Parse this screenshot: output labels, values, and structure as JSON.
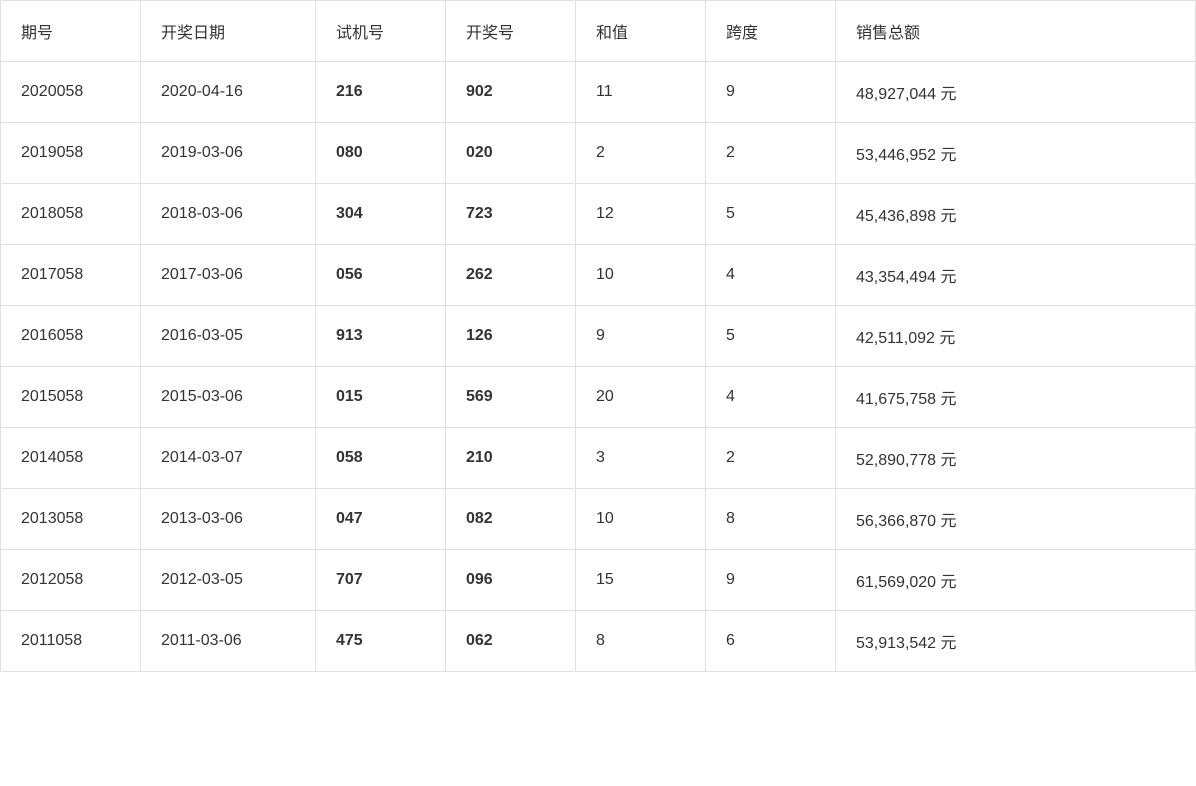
{
  "table": {
    "headers": [
      "期号",
      "开奖日期",
      "试机号",
      "开奖号",
      "和值",
      "跨度",
      "销售总额"
    ],
    "rows": [
      {
        "qihao": "2020058",
        "date": "2020-04-16",
        "shiji": "216",
        "kaijang": "902",
        "hezhi": "11",
        "kuadu": "9",
        "sales": "48,927,044 元"
      },
      {
        "qihao": "2019058",
        "date": "2019-03-06",
        "shiji": "080",
        "kaijang": "020",
        "hezhi": "2",
        "kuadu": "2",
        "sales": "53,446,952 元"
      },
      {
        "qihao": "2018058",
        "date": "2018-03-06",
        "shiji": "304",
        "kaijang": "723",
        "hezhi": "12",
        "kuadu": "5",
        "sales": "45,436,898 元"
      },
      {
        "qihao": "2017058",
        "date": "2017-03-06",
        "shiji": "056",
        "kaijang": "262",
        "hezhi": "10",
        "kuadu": "4",
        "sales": "43,354,494 元"
      },
      {
        "qihao": "2016058",
        "date": "2016-03-05",
        "shiji": "913",
        "kaijang": "126",
        "hezhi": "9",
        "kuadu": "5",
        "sales": "42,511,092 元"
      },
      {
        "qihao": "2015058",
        "date": "2015-03-06",
        "shiji": "015",
        "kaijang": "569",
        "hezhi": "20",
        "kuadu": "4",
        "sales": "41,675,758 元"
      },
      {
        "qihao": "2014058",
        "date": "2014-03-07",
        "shiji": "058",
        "kaijang": "210",
        "hezhi": "3",
        "kuadu": "2",
        "sales": "52,890,778 元"
      },
      {
        "qihao": "2013058",
        "date": "2013-03-06",
        "shiji": "047",
        "kaijang": "082",
        "hezhi": "10",
        "kuadu": "8",
        "sales": "56,366,870 元"
      },
      {
        "qihao": "2012058",
        "date": "2012-03-05",
        "shiji": "707",
        "kaijang": "096",
        "hezhi": "15",
        "kuadu": "9",
        "sales": "61,569,020 元"
      },
      {
        "qihao": "2011058",
        "date": "2011-03-06",
        "shiji": "475",
        "kaijang": "062",
        "hezhi": "8",
        "kuadu": "6",
        "sales": "53,913,542 元"
      }
    ]
  }
}
